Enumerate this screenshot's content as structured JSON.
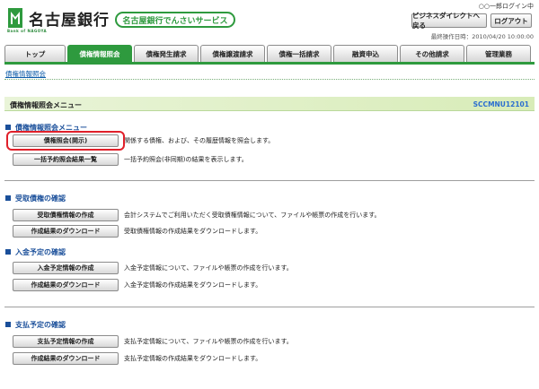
{
  "header": {
    "bank_name": "名古屋銀行",
    "logo_sub": "Bank of NAGOYA",
    "service_name": "名古屋銀行でんさいサービス",
    "user_line": "○○一郎ログイン中",
    "business_direct_button": "ビジネスダイレクトへ戻る",
    "logout_button": "ログアウト",
    "last_operation": "最終操作日時：2010/04/20 10:00:00"
  },
  "tabs": [
    {
      "label": "トップ",
      "active": false
    },
    {
      "label": "債権情報照会",
      "active": true
    },
    {
      "label": "債権発生請求",
      "active": false
    },
    {
      "label": "債権譲渡請求",
      "active": false
    },
    {
      "label": "債権一括請求",
      "active": false
    },
    {
      "label": "融資申込",
      "active": false
    },
    {
      "label": "その他請求",
      "active": false
    },
    {
      "label": "管理業務",
      "active": false
    }
  ],
  "breadcrumb": "債権情報照会",
  "page": {
    "title": "債権情報照会メニュー",
    "screen_id": "SCCMNU12101"
  },
  "sections": [
    {
      "heading": "債権情報照会メニュー",
      "rows": [
        {
          "button": "債権照会(開示)",
          "desc": "関係する債権、および、その履歴情報を照会します。"
        },
        {
          "button": "一括予約照会結果一覧",
          "desc": "一括予約照会(非同期)の結果を表示します。"
        }
      ]
    },
    {
      "heading": "受取債権の確認",
      "rows": [
        {
          "button": "受取債権情報の作成",
          "desc": "会計システムでご利用いただく受取債権情報について、ファイルや帳票の作成を行います。"
        },
        {
          "button": "作成結果のダウンロード",
          "desc": "受取債権情報の作成結果をダウンロードします。"
        }
      ]
    },
    {
      "heading": "入金予定の確認",
      "rows": [
        {
          "button": "入金予定情報の作成",
          "desc": "入金予定情報について、ファイルや帳票の作成を行います。"
        },
        {
          "button": "作成結果のダウンロード",
          "desc": "入金予定情報の作成結果をダウンロードします。"
        }
      ]
    },
    {
      "heading": "支払予定の確認",
      "rows": [
        {
          "button": "支払予定情報の作成",
          "desc": "支払予定情報について、ファイルや帳票の作成を行います。"
        },
        {
          "button": "作成結果のダウンロード",
          "desc": "支払予定情報の作成結果をダウンロードします。"
        }
      ]
    }
  ],
  "colors": {
    "brand_green": "#2e9a3e",
    "section_blue": "#1a4f9a",
    "highlight_red": "#e0202a"
  }
}
